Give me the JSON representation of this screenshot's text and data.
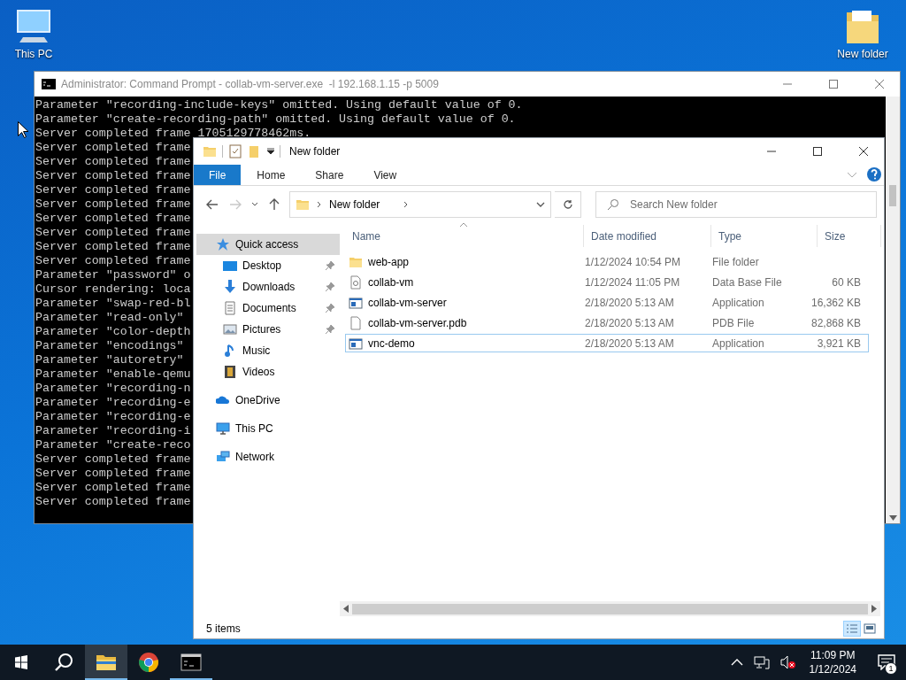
{
  "desktop_icons": [
    {
      "label": "This PC",
      "kind": "pc"
    },
    {
      "label": "New folder",
      "kind": "folder"
    }
  ],
  "console": {
    "title": "Administrator: Command Prompt - collab-vm-server.exe  -l 192.168.1.15 -p 5009",
    "lines": [
      "Parameter \"recording-include-keys\" omitted. Using default value of 0.",
      "Parameter \"create-recording-path\" omitted. Using default value of 0.",
      "Server completed frame 1705129778462ms.",
      "Server completed frame",
      "Server completed frame",
      "Server completed frame",
      "Server completed frame",
      "Server completed frame",
      "Server completed frame",
      "Server completed frame",
      "Server completed frame",
      "Server completed frame",
      "Parameter \"password\" o",
      "Cursor rendering: loca",
      "Parameter \"swap-red-bl",
      "Parameter \"read-only\"",
      "Parameter \"color-depth",
      "Parameter \"encodings\"",
      "Parameter \"autoretry\"",
      "Parameter \"enable-qemu",
      "Parameter \"recording-n",
      "Parameter \"recording-e",
      "Parameter \"recording-e",
      "Parameter \"recording-i",
      "Parameter \"create-reco",
      "Server completed frame",
      "Server completed frame",
      "Server completed frame",
      "Server completed frame"
    ]
  },
  "explorer": {
    "title": "New folder",
    "ribbon_tabs": [
      {
        "label": "File",
        "selected": true
      },
      {
        "label": "Home",
        "selected": false
      },
      {
        "label": "Share",
        "selected": false
      },
      {
        "label": "View",
        "selected": false
      }
    ],
    "address": "New folder",
    "search": {
      "placeholder": "Search New folder"
    },
    "nav": [
      {
        "label": "Quick access",
        "kind": "star",
        "selected": true,
        "children": [
          {
            "label": "Desktop",
            "kind": "desktop",
            "selected": false,
            "pinned": true
          },
          {
            "label": "Downloads",
            "kind": "download",
            "selected": false,
            "pinned": true
          },
          {
            "label": "Documents",
            "kind": "document",
            "selected": false,
            "pinned": true
          },
          {
            "label": "Pictures",
            "kind": "picture",
            "selected": false,
            "pinned": true
          },
          {
            "label": "Music",
            "kind": "music",
            "selected": false,
            "pinned": false
          },
          {
            "label": "Videos",
            "kind": "video",
            "selected": false,
            "pinned": false
          }
        ]
      },
      {
        "label": "OneDrive",
        "kind": "cloud",
        "selected": false
      },
      {
        "label": "This PC",
        "kind": "pc",
        "selected": false
      },
      {
        "label": "Network",
        "kind": "network",
        "selected": false
      }
    ],
    "columns": [
      "Name",
      "Date modified",
      "Type",
      "Size"
    ],
    "files": [
      {
        "name": "web-app",
        "kind": "folder",
        "date": "1/12/2024 10:54 PM",
        "type": "File folder",
        "focused": false
      },
      {
        "name": "collab-vm",
        "kind": "db",
        "date": "1/12/2024 11:05 PM",
        "type": "Data Base File",
        "size": "60 KB",
        "focused": false
      },
      {
        "name": "collab-vm-server",
        "kind": "app",
        "date": "2/18/2020 5:13 AM",
        "type": "Application",
        "size": "16,362 KB",
        "focused": false
      },
      {
        "name": "collab-vm-server.pdb",
        "kind": "file",
        "date": "2/18/2020 5:13 AM",
        "type": "PDB File",
        "size": "82,868 KB",
        "focused": false
      },
      {
        "name": "vnc-demo",
        "kind": "app",
        "date": "2/18/2020 5:13 AM",
        "type": "Application",
        "size": "3,921 KB",
        "focused": true
      }
    ],
    "status": "5 items"
  },
  "taskbar": {
    "apps": [
      {
        "kind": "explorer",
        "active": true,
        "running": true
      },
      {
        "kind": "chrome",
        "active": false,
        "running": false
      },
      {
        "kind": "terminal",
        "active": false,
        "running": true
      }
    ],
    "time": "11:09 PM",
    "date": "1/12/2024",
    "notifications": "1"
  }
}
